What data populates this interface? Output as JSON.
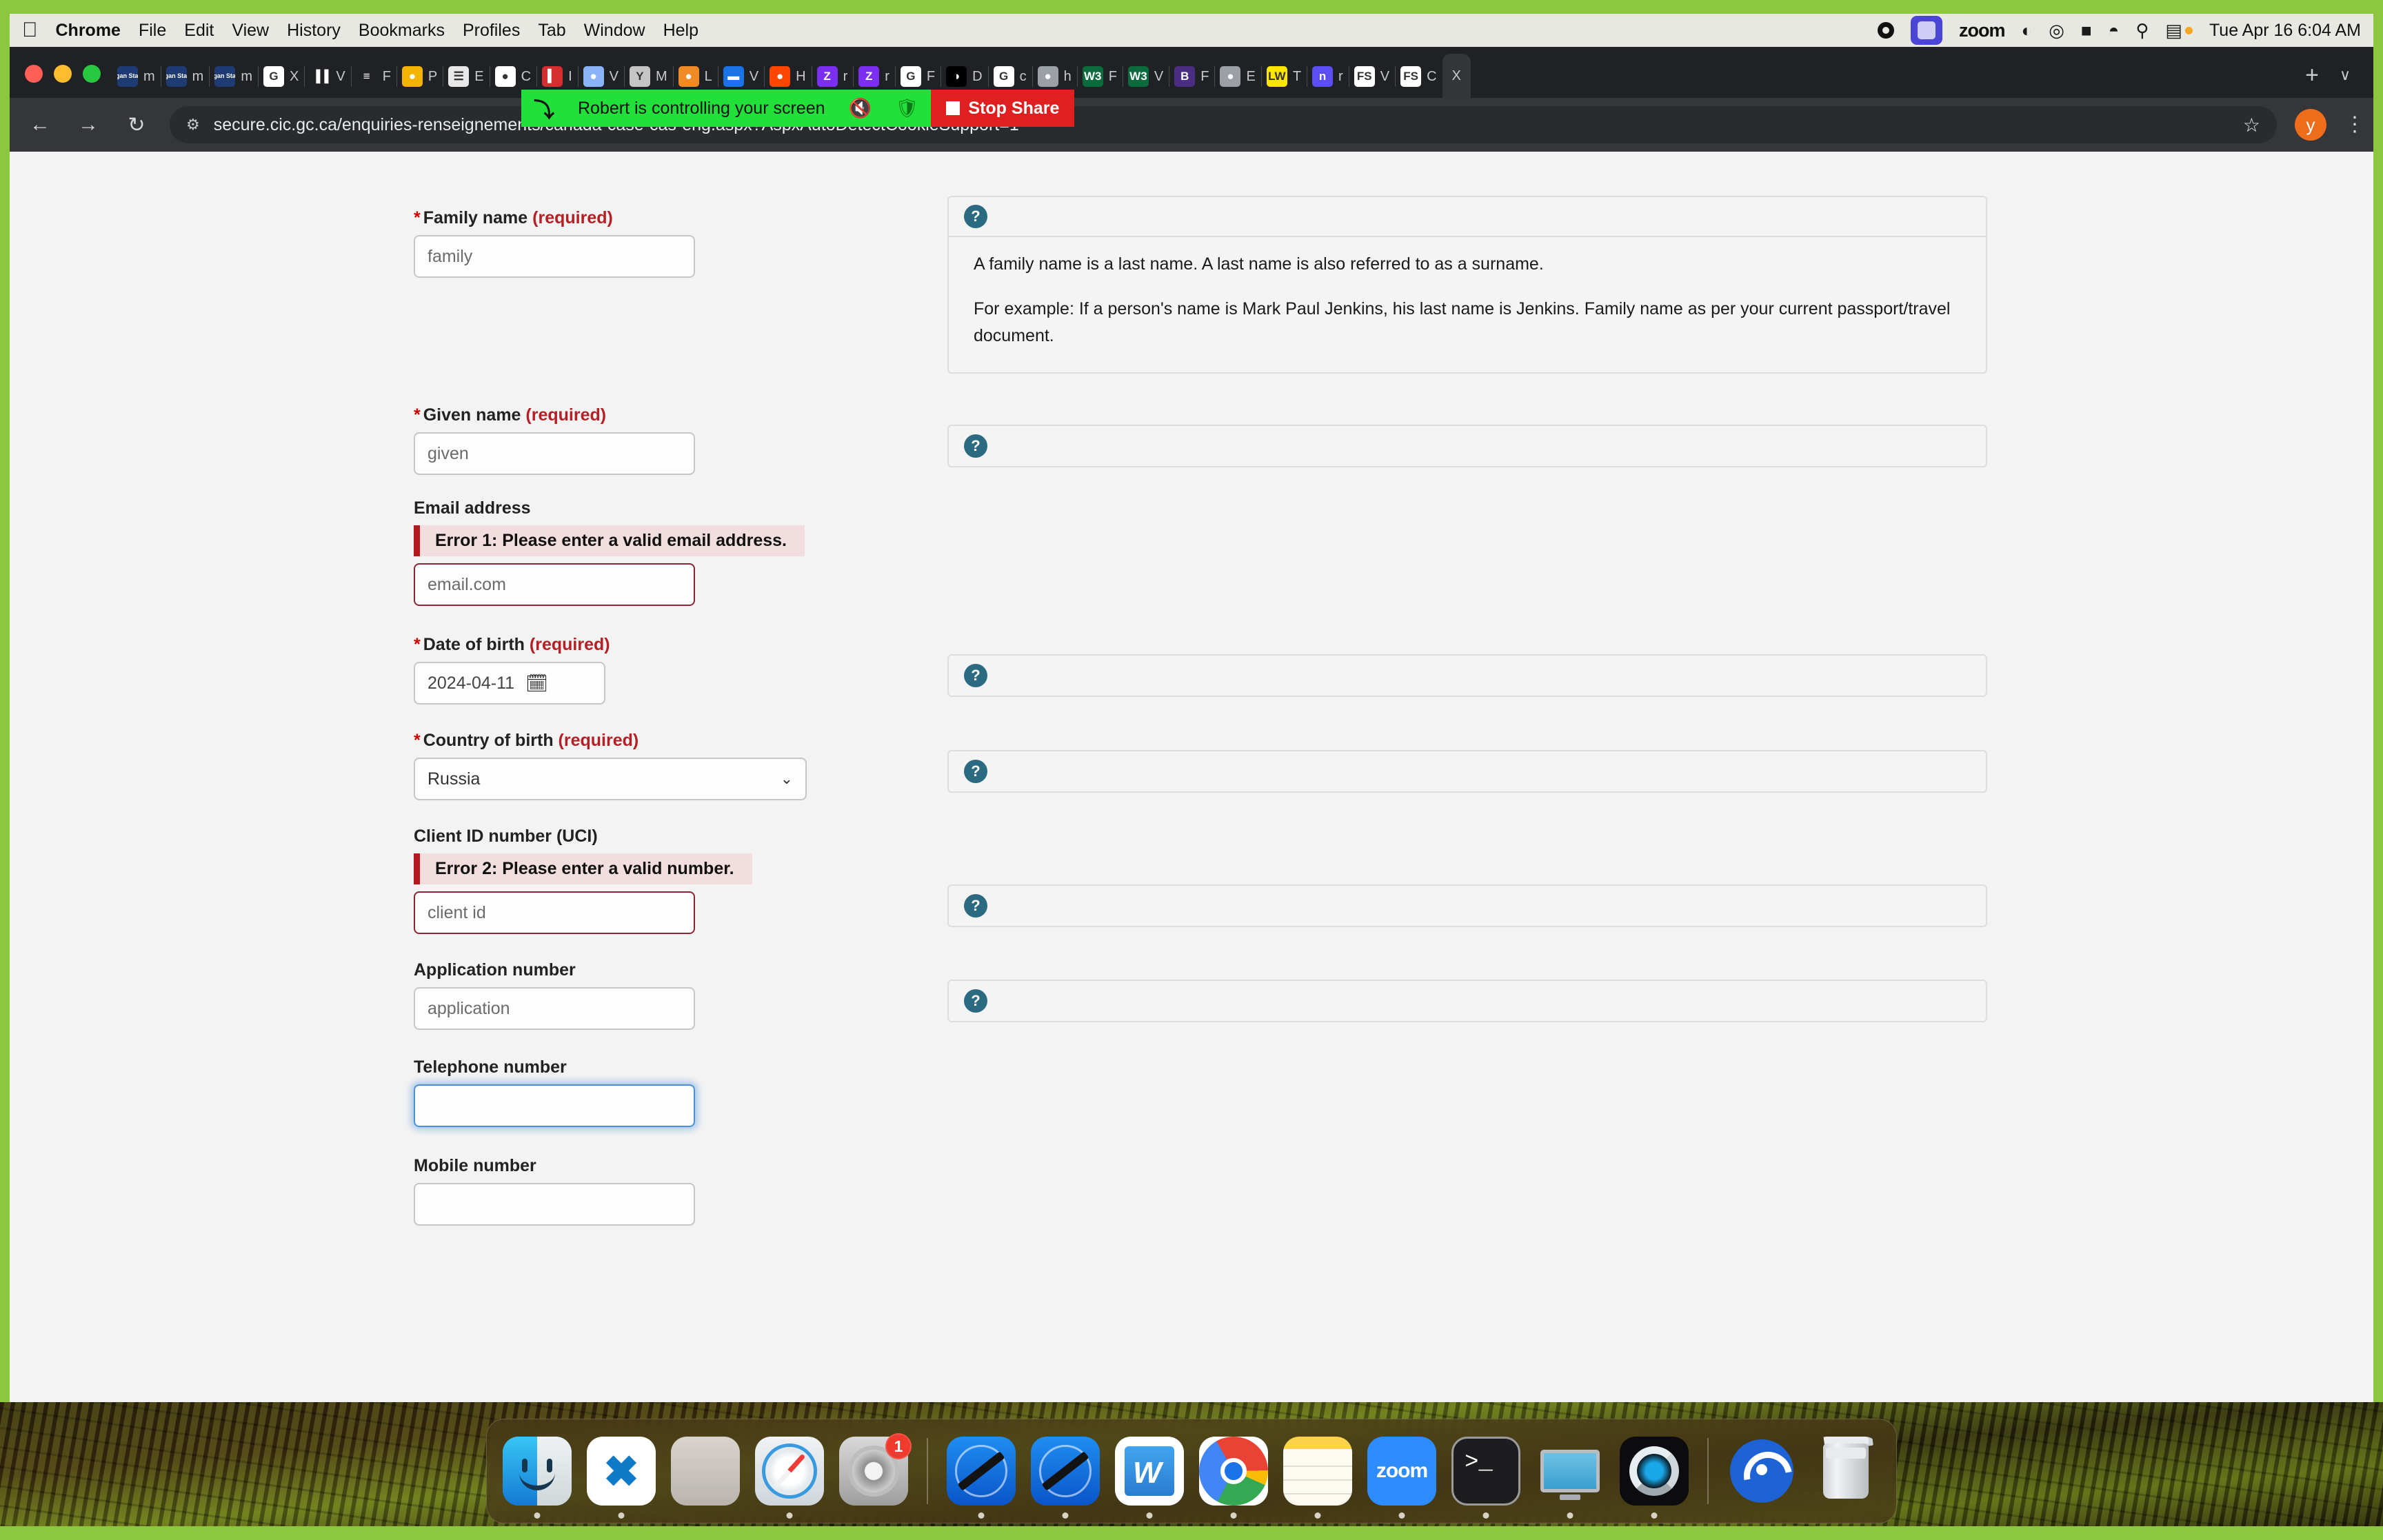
{
  "menubar": {
    "apple_glyph": "",
    "items": [
      {
        "label": "Chrome",
        "bold": true
      },
      {
        "label": "File",
        "bold": false
      },
      {
        "label": "Edit",
        "bold": false
      },
      {
        "label": "View",
        "bold": false
      },
      {
        "label": "History",
        "bold": false
      },
      {
        "label": "Bookmarks",
        "bold": false
      },
      {
        "label": "Profiles",
        "bold": false
      },
      {
        "label": "Tab",
        "bold": false
      },
      {
        "label": "Window",
        "bold": false
      },
      {
        "label": "Help",
        "bold": false
      }
    ],
    "zoom_label": "zoom",
    "clock": "Tue Apr 16  6:04 AM",
    "icons": [
      "record-icon",
      "screen-share-icon",
      "zoom-icon",
      "siri-icon",
      "screen-recording-icon",
      "battery-icon",
      "wifi-icon",
      "search-icon",
      "control-center-icon"
    ]
  },
  "share_banner": {
    "message": "Robert is controlling your screen",
    "stop_label": "Stop Share",
    "mic_icon": "microphone-muted-icon",
    "shield_icon": "shield-check-icon",
    "pointer_icon": "remote-pointer-icon"
  },
  "window_controls": {
    "close": "close",
    "minimize": "minimize",
    "zoom": "zoom"
  },
  "tabstrip": {
    "new_tab_label": "+",
    "tab_list_label": "∨",
    "tabs": [
      {
        "favicon": "morgan-stanley",
        "title": "m",
        "color": "#1f3b73",
        "text": "Morgan Stanley",
        "active": false
      },
      {
        "favicon": "morgan-stanley",
        "title": "m",
        "color": "#1f3b73",
        "text": "Morgan Stanley",
        "active": false
      },
      {
        "favicon": "morgan-stanley",
        "title": "m",
        "color": "#1f3b73",
        "text": "Morgan Stanley",
        "active": false
      },
      {
        "favicon": "google",
        "title": "X",
        "color": "#ffffff",
        "text": "G",
        "active": false
      },
      {
        "favicon": "parallels",
        "title": "V",
        "color": "#202124",
        "text": "▐▐",
        "active": false
      },
      {
        "favicon": "stack-overflow",
        "title": "F",
        "color": "#202124",
        "text": "≡",
        "active": false
      },
      {
        "favicon": "bee",
        "title": "P",
        "color": "#f5b301",
        "text": "●",
        "active": false
      },
      {
        "favicon": "document",
        "title": "E",
        "color": "#e8e8e8",
        "text": "☰",
        "active": false
      },
      {
        "favicon": "canada",
        "title": "C",
        "color": "#ffffff",
        "text": "●",
        "active": false
      },
      {
        "favicon": "red",
        "title": "I",
        "color": "#d32f2f",
        "text": "▍",
        "active": false
      },
      {
        "favicon": "shield",
        "title": "V",
        "color": "#8ab4f8",
        "text": "●",
        "active": false
      },
      {
        "favicon": "yeti",
        "title": "M",
        "color": "#c5c5c5",
        "text": "Y",
        "active": false
      },
      {
        "favicon": "firefox",
        "title": "L",
        "color": "#f08a24",
        "text": "●",
        "active": false
      },
      {
        "favicon": "folder",
        "title": "V",
        "color": "#1a73e8",
        "text": "▬",
        "active": false
      },
      {
        "favicon": "reddit",
        "title": "H",
        "color": "#ff4500",
        "text": "●",
        "active": false
      },
      {
        "favicon": "zoho",
        "title": "r",
        "color": "#7b2ff2",
        "text": "Z",
        "active": false
      },
      {
        "favicon": "zoho",
        "title": "r",
        "color": "#7b2ff2",
        "text": "Z",
        "active": false
      },
      {
        "favicon": "google",
        "title": "F",
        "color": "#ffffff",
        "text": "G",
        "active": false
      },
      {
        "favicon": "half-circle",
        "title": "D",
        "color": "#000000",
        "text": "◑",
        "active": false
      },
      {
        "favicon": "google",
        "title": "c",
        "color": "#ffffff",
        "text": "G",
        "active": false
      },
      {
        "favicon": "ghost",
        "title": "h",
        "color": "#9aa0a6",
        "text": "●",
        "active": false
      },
      {
        "favicon": "w3-green",
        "title": "F",
        "color": "#0c6b3d",
        "text": "W3",
        "active": false
      },
      {
        "favicon": "w3-green",
        "title": "V",
        "color": "#0c6b3d",
        "text": "W3",
        "active": false
      },
      {
        "favicon": "blackboard",
        "title": "F",
        "color": "#4b2e83",
        "text": "B",
        "active": false
      },
      {
        "favicon": "globe",
        "title": "E",
        "color": "#9aa0a6",
        "text": "●",
        "active": false
      },
      {
        "favicon": "lw-yellow",
        "title": "T",
        "color": "#ffe600",
        "text": "LW",
        "active": false
      },
      {
        "favicon": "nocc",
        "title": "r",
        "color": "#5b4ef5",
        "text": "n",
        "active": false
      },
      {
        "favicon": "fs-blue",
        "title": "V",
        "color": "#ffffff",
        "text": "FS",
        "active": false
      },
      {
        "favicon": "fs-blue",
        "title": "C",
        "color": "#ffffff",
        "text": "FS",
        "active": false
      },
      {
        "favicon": "active-tab",
        "title": "X",
        "color": "#323639",
        "text": "",
        "active": true
      }
    ]
  },
  "toolbar": {
    "back_icon": "back-arrow-icon",
    "forward_icon": "forward-arrow-icon",
    "reload_icon": "reload-icon",
    "site_info_icon": "site-settings-icon",
    "url": "secure.cic.gc.ca/enquiries-renseignements/canada-case-cas-eng.aspx?AspxAutoDetectCookieSupport=1",
    "bookmark_icon": "star-icon",
    "avatar_letter": "y",
    "menu_icon": "kebab-menu-icon"
  },
  "form": {
    "required_suffix": "(required)",
    "fields": [
      {
        "id": "family-name",
        "label": "Family name",
        "required": true,
        "value": "family",
        "is_placeholder": true,
        "error": null,
        "help_expanded": true,
        "help_paragraphs": [
          "A family name is a last name. A last name is also referred to as a surname.",
          "For example: If a person's name is Mark Paul Jenkins, his last name is Jenkins. Family name as per your current passport/travel document."
        ]
      },
      {
        "id": "given-name",
        "label": "Given name",
        "required": true,
        "value": "given",
        "is_placeholder": true,
        "error": null,
        "help_expanded": false,
        "help_paragraphs": []
      },
      {
        "id": "email-address",
        "label": "Email address",
        "required": false,
        "value": "email.com",
        "is_placeholder": true,
        "error": "Error 1: Please enter a valid email address.",
        "help_expanded": null,
        "help_paragraphs": []
      },
      {
        "id": "date-of-birth",
        "label": "Date of birth",
        "required": true,
        "value": "2024-04-11",
        "is_placeholder": false,
        "error": null,
        "help_expanded": false,
        "help_paragraphs": []
      },
      {
        "id": "country-of-birth",
        "label": "Country of birth",
        "required": true,
        "value": "Russia",
        "is_placeholder": false,
        "error": null,
        "help_expanded": false,
        "help_paragraphs": []
      },
      {
        "id": "client-id-number",
        "label": "Client ID number (UCI)",
        "required": false,
        "value": "client id",
        "is_placeholder": true,
        "error": "Error 2: Please enter a valid number.",
        "help_expanded": false,
        "help_paragraphs": []
      },
      {
        "id": "application-number",
        "label": "Application number",
        "required": false,
        "value": "application",
        "is_placeholder": true,
        "error": null,
        "help_expanded": false,
        "help_paragraphs": []
      },
      {
        "id": "telephone-number",
        "label": "Telephone number",
        "required": false,
        "value": "",
        "is_placeholder": false,
        "error": null,
        "help_expanded": null,
        "help_paragraphs": []
      },
      {
        "id": "mobile-number",
        "label": "Mobile number",
        "required": false,
        "value": "",
        "is_placeholder": false,
        "error": null,
        "help_expanded": null,
        "help_paragraphs": []
      }
    ]
  },
  "dock": {
    "items": [
      {
        "name": "finder",
        "label": "Finder",
        "running": true,
        "badge": null
      },
      {
        "name": "vscode",
        "label": "Visual Studio Code",
        "running": true,
        "badge": null
      },
      {
        "name": "launchpad",
        "label": "Launchpad",
        "running": false,
        "badge": null
      },
      {
        "name": "safari",
        "label": "Safari",
        "running": true,
        "badge": null
      },
      {
        "name": "system-settings",
        "label": "System Settings",
        "running": false,
        "badge": "1"
      },
      {
        "name": "xcode",
        "label": "Xcode",
        "running": true,
        "badge": null
      },
      {
        "name": "xcode-beta",
        "label": "Xcode Beta",
        "running": true,
        "badge": null
      },
      {
        "name": "word",
        "label": "Microsoft Word",
        "running": true,
        "badge": null
      },
      {
        "name": "chrome",
        "label": "Google Chrome",
        "running": true,
        "badge": null
      },
      {
        "name": "notes",
        "label": "Notes",
        "running": true,
        "badge": null
      },
      {
        "name": "zoom",
        "label": "zoom",
        "running": true,
        "badge": null
      },
      {
        "name": "terminal",
        "label": "Terminal",
        "running": true,
        "badge": null
      },
      {
        "name": "display",
        "label": "Display",
        "running": true,
        "badge": null
      },
      {
        "name": "quicktime",
        "label": "QuickTime Player",
        "running": true,
        "badge": null
      },
      {
        "name": "airdrop",
        "label": "AirDrop",
        "running": false,
        "badge": null
      },
      {
        "name": "trash",
        "label": "Trash",
        "running": false,
        "badge": null
      }
    ],
    "zoom_text": "zoom",
    "terminal_text": ">_",
    "word_letter": "W",
    "vscode_glyph": "✖"
  },
  "colors": {
    "accent_green": "#8dc63f",
    "share_green": "#22e03a",
    "stop_red": "#e02020",
    "error_red": "#b3191f",
    "error_bg": "#f2dede",
    "required_red": "#b32025",
    "help_teal": "#2b6a80",
    "chrome_dark": "#202124",
    "page_bg": "#f3f3f3"
  }
}
